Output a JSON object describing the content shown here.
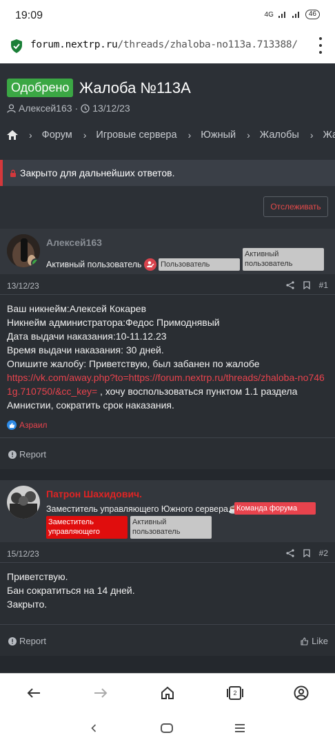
{
  "status": {
    "time": "19:09",
    "network": "4G",
    "battery": "46"
  },
  "browser": {
    "url_host": "forum.nextrp.ru",
    "url_path": "/threads/zhaloba-no113a.713388/",
    "tabs_count": "2"
  },
  "thread": {
    "prefix": "Одобрено",
    "title": "Жалоба №113А",
    "author": "Алексей163",
    "date": "13/12/23"
  },
  "breadcrumbs": [
    "Форум",
    "Игровые сервера",
    "Южный",
    "Жалобы",
    "Жал"
  ],
  "closed_notice": "Закрыто для дальнейших ответов.",
  "watch_label": "Отслеживать",
  "posts": [
    {
      "username": "Алексей163",
      "user_title": "Активный пользователь",
      "badges": [
        "Пользователь",
        "Активный пользователь"
      ],
      "date": "13/12/23",
      "number": "#1",
      "lines": [
        "Ваш никнейм:Алексей Кокарев",
        "Никнейм администратора:Федос Примоднявый",
        "Дата выдачи наказания:10-11.12.23",
        "Время выдачи наказания: 30 дней.",
        "Опишите жалобу: Приветствую, был забанен по жалобе"
      ],
      "link": "https://vk.com/away.php?to=https://forum.nextrp.ru/threads/zhaloba-no7461g.710750/&cc_key=",
      "link_after": " , хочу воспользоваться пунктом 1.1 раздела Амнистии, сократить срок наказания.",
      "reaction_user": "Азраил",
      "report_label": "Report"
    },
    {
      "username": "Патрон Шахидович.",
      "user_title": "Заместитель управляющего Южного сервера☕",
      "badges": [
        "Команда форума",
        "Заместитель управляющего",
        "Активный пользователь"
      ],
      "date": "15/12/23",
      "number": "#2",
      "lines": [
        "Приветствую.",
        "Бан сократиться на 14 дней.",
        "Закрыто."
      ],
      "report_label": "Report",
      "like_label": "Like"
    }
  ],
  "colors": {
    "accent_red": "#e8434d",
    "approved_green": "#3ba744",
    "page_bg": "#2c3036"
  }
}
